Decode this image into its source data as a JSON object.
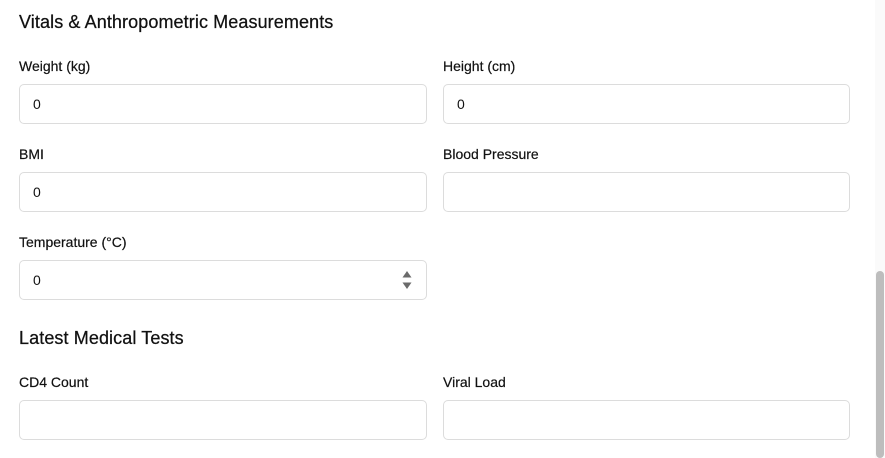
{
  "vitals": {
    "title": "Vitals & Anthropometric Measurements",
    "weight": {
      "label": "Weight (kg)",
      "value": "0"
    },
    "height": {
      "label": "Height (cm)",
      "value": "0"
    },
    "bmi": {
      "label": "BMI",
      "value": "0"
    },
    "blood_pressure": {
      "label": "Blood Pressure",
      "value": ""
    },
    "temperature": {
      "label": "Temperature (°C)",
      "value": "0",
      "stepper_icon": "up-down-arrows-icon"
    }
  },
  "tests": {
    "title": "Latest Medical Tests",
    "cd4": {
      "label": "CD4 Count",
      "value": ""
    },
    "viral_load": {
      "label": "Viral Load",
      "value": ""
    }
  },
  "colors": {
    "border": "#dcdcdc",
    "text": "#111111",
    "scrollbar_thumb": "#bdbdbd"
  }
}
